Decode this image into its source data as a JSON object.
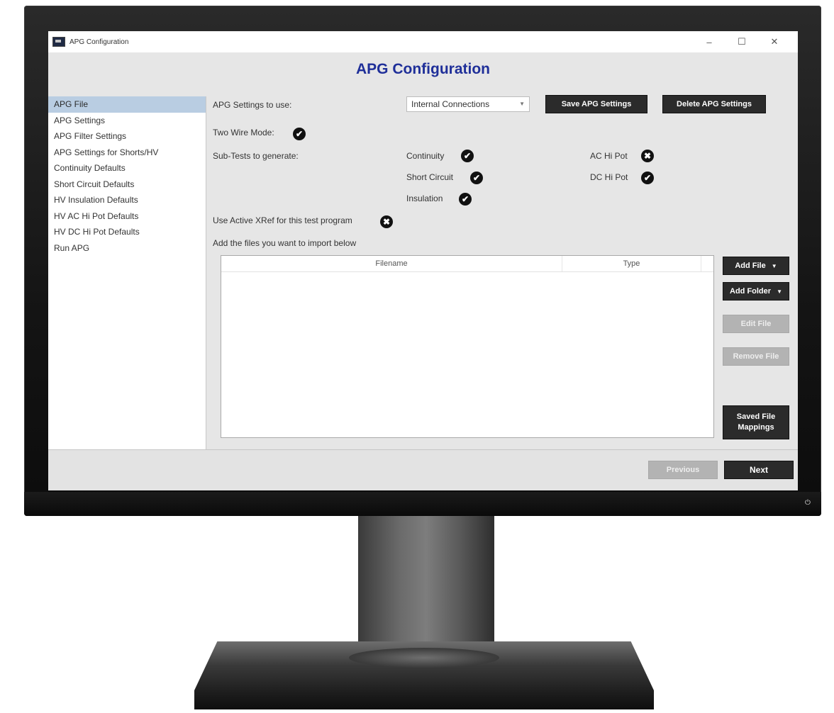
{
  "window": {
    "title": "APG Configuration",
    "controls": {
      "minimize": "–",
      "maximize": "☐",
      "close": "✕"
    }
  },
  "heading": "APG Configuration",
  "sidebar": {
    "items": [
      {
        "label": "APG File",
        "active": true
      },
      {
        "label": "APG Settings"
      },
      {
        "label": "APG Filter Settings"
      },
      {
        "label": "APG Settings for Shorts/HV"
      },
      {
        "label": "Continuity Defaults"
      },
      {
        "label": "Short Circuit Defaults"
      },
      {
        "label": "HV Insulation Defaults"
      },
      {
        "label": "HV AC Hi Pot Defaults"
      },
      {
        "label": "HV DC Hi Pot Defaults"
      },
      {
        "label": "Run APG"
      }
    ]
  },
  "settings": {
    "apg_settings_label": "APG Settings to use:",
    "apg_settings_value": "Internal Connections",
    "save_button": "Save APG Settings",
    "delete_button": "Delete APG Settings",
    "two_wire_label": "Two Wire Mode:",
    "two_wire_checked": true,
    "subtests_label": "Sub-Tests to generate:",
    "subtests": {
      "continuity": {
        "label": "Continuity",
        "checked": true
      },
      "short_circuit": {
        "label": "Short Circuit",
        "checked": true
      },
      "insulation": {
        "label": "Insulation",
        "checked": true
      },
      "ac_hi_pot": {
        "label": "AC Hi Pot",
        "checked": false
      },
      "dc_hi_pot": {
        "label": "DC Hi Pot",
        "checked": true
      }
    },
    "xref_label": "Use Active XRef for this test program",
    "xref_checked": false,
    "import_label": "Add the files you want to import below"
  },
  "table": {
    "columns": [
      "Filename",
      "Type"
    ],
    "rows": []
  },
  "file_buttons": {
    "add_file": "Add File",
    "add_folder": "Add Folder",
    "edit_file": "Edit File",
    "remove_file": "Remove File",
    "saved_mappings_line1": "Saved File",
    "saved_mappings_line2": "Mappings"
  },
  "nav": {
    "previous": "Previous",
    "next": "Next"
  },
  "icons": {
    "power": "⏻",
    "check": "✔",
    "x": "✖",
    "caret": "▼"
  }
}
